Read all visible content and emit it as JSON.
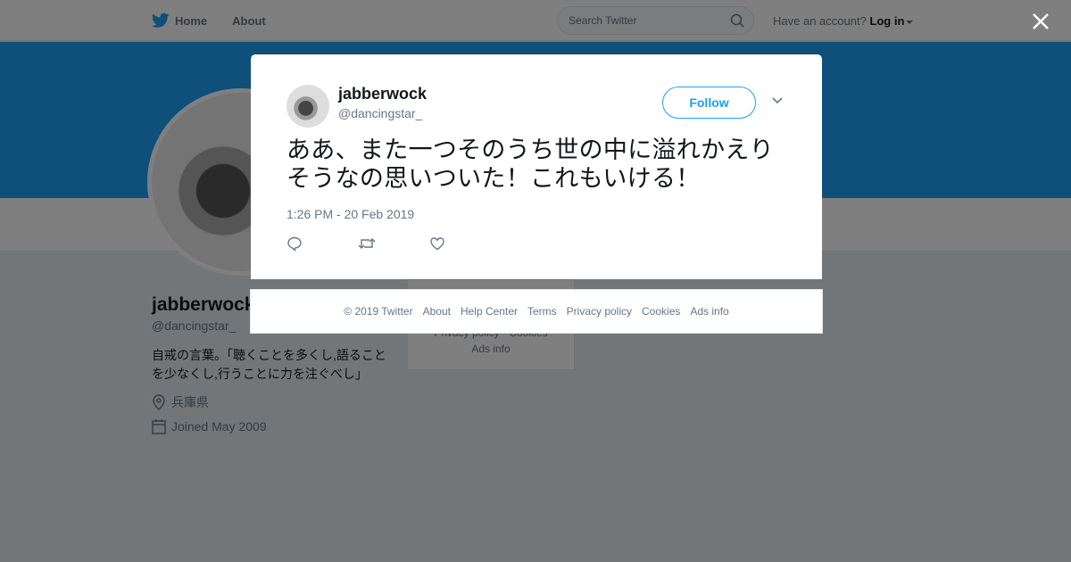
{
  "nav": {
    "home_label": "Home",
    "about_label": "About",
    "search_placeholder": "Search Twitter",
    "account_prompt": "Have an account?",
    "login_label": "Log in"
  },
  "profile": {
    "name": "jabberwock",
    "handle": "@dancingstar_",
    "bio": "自戒の言葉。「聴くことを多くし,語ることを少なくし,行うことに力を注ぐべし」",
    "location": "兵庫県",
    "joined": "Joined May 2009"
  },
  "side_card": {
    "row1": "Privacy policy · Cookies",
    "row2": "Ads info"
  },
  "tweet": {
    "author_name": "jabberwock",
    "author_handle": "@dancingstar_",
    "follow_label": "Follow",
    "text": "ああ、また一つそのうち世の中に溢れかえりそうなの思いついた！これもいける！",
    "timestamp": "1:26 PM - 20 Feb 2019"
  },
  "footer": {
    "links": [
      "© 2019 Twitter",
      "About",
      "Help Center",
      "Terms",
      "Privacy policy",
      "Cookies",
      "Ads info"
    ]
  },
  "colors": {
    "accent": "#1da1f2",
    "banner": "#1da1f2"
  },
  "icons": [
    "twitter-bird-icon",
    "home-icon",
    "search-icon",
    "close-icon",
    "chevron-down-icon",
    "reply-icon",
    "retweet-icon",
    "like-icon",
    "location-icon",
    "calendar-icon"
  ]
}
